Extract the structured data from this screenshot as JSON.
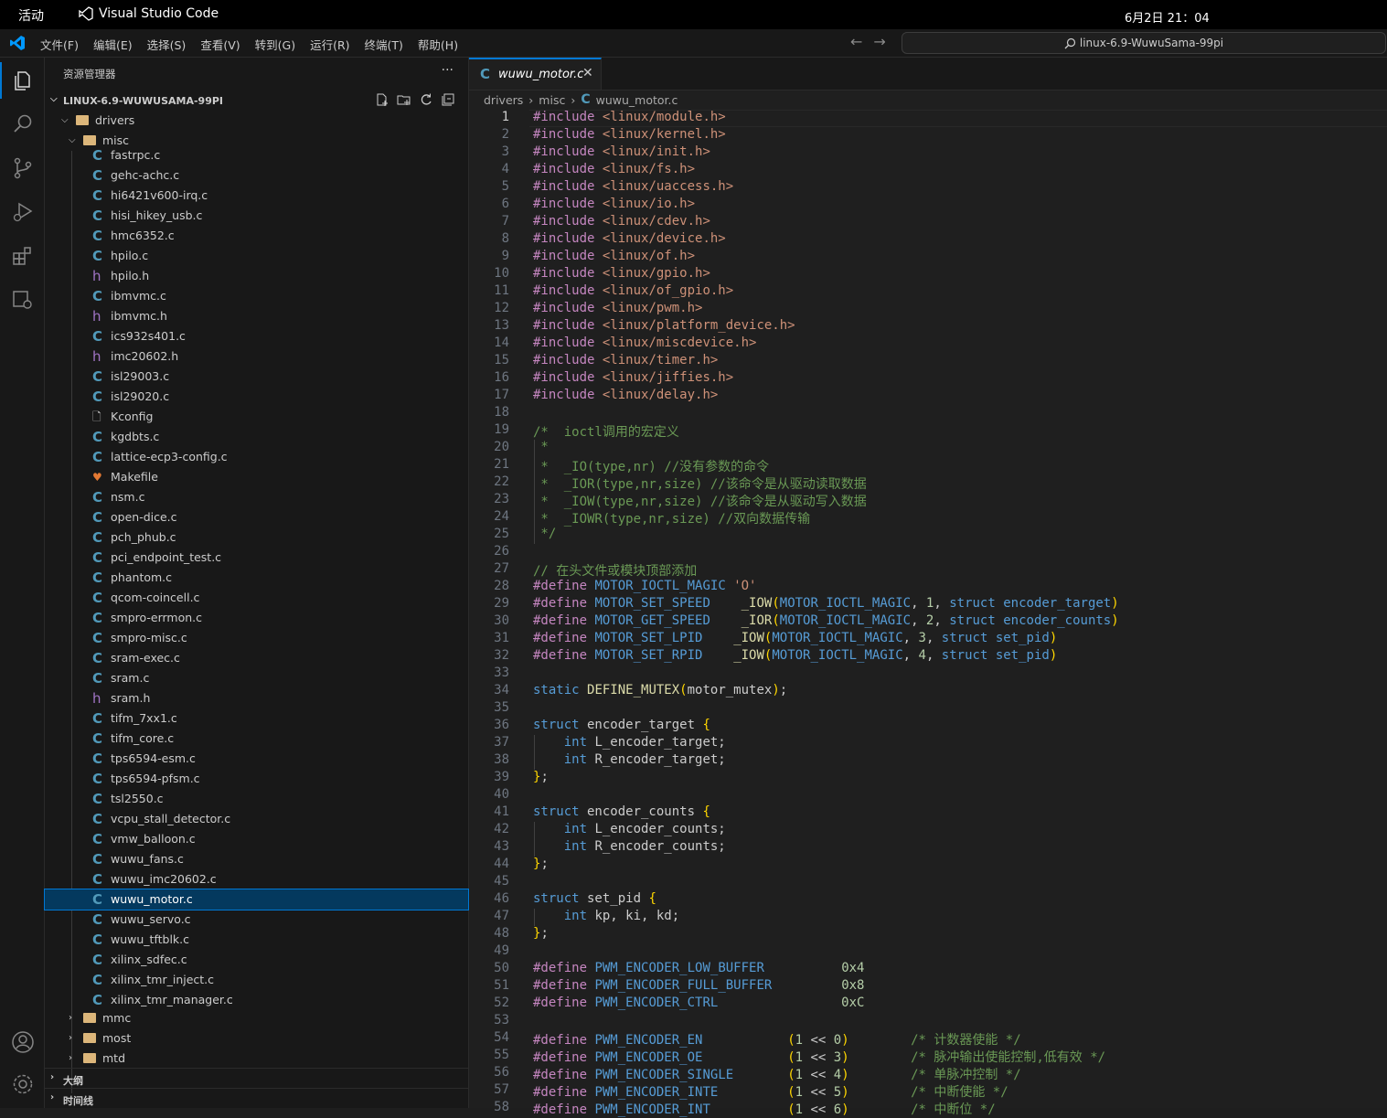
{
  "topbar": {
    "activities": "活动",
    "app_name": "Visual Studio Code",
    "clock": "6月2日  21：04"
  },
  "menubar": {
    "menus": [
      "文件(F)",
      "编辑(E)",
      "选择(S)",
      "查看(V)",
      "转到(G)",
      "运行(R)",
      "终端(T)",
      "帮助(H)"
    ],
    "search_text": "linux-6.9-WuwuSama-99pi"
  },
  "sidebar": {
    "title": "资源管理器",
    "project": "LINUX-6.9-WUWUSAMA-99PI",
    "folder_drivers": "drivers",
    "folder_misc": "misc",
    "files": [
      {
        "name": "fastrpc.c",
        "icon": "c-file-icon"
      },
      {
        "name": "gehc-achc.c",
        "icon": "c-file-icon"
      },
      {
        "name": "hi6421v600-irq.c",
        "icon": "c-file-icon"
      },
      {
        "name": "hisi_hikey_usb.c",
        "icon": "c-file-icon"
      },
      {
        "name": "hmc6352.c",
        "icon": "c-file-icon"
      },
      {
        "name": "hpilo.c",
        "icon": "c-file-icon"
      },
      {
        "name": "hpilo.h",
        "icon": "h-file-icon"
      },
      {
        "name": "ibmvmc.c",
        "icon": "c-file-icon"
      },
      {
        "name": "ibmvmc.h",
        "icon": "h-file-icon"
      },
      {
        "name": "ics932s401.c",
        "icon": "c-file-icon"
      },
      {
        "name": "imc20602.h",
        "icon": "h-file-icon"
      },
      {
        "name": "isl29003.c",
        "icon": "c-file-icon"
      },
      {
        "name": "isl29020.c",
        "icon": "c-file-icon"
      },
      {
        "name": "Kconfig",
        "icon": "kconfig-file-icon"
      },
      {
        "name": "kgdbts.c",
        "icon": "c-file-icon"
      },
      {
        "name": "lattice-ecp3-config.c",
        "icon": "c-file-icon"
      },
      {
        "name": "Makefile",
        "icon": "makefile-icon"
      },
      {
        "name": "nsm.c",
        "icon": "c-file-icon"
      },
      {
        "name": "open-dice.c",
        "icon": "c-file-icon"
      },
      {
        "name": "pch_phub.c",
        "icon": "c-file-icon"
      },
      {
        "name": "pci_endpoint_test.c",
        "icon": "c-file-icon"
      },
      {
        "name": "phantom.c",
        "icon": "c-file-icon"
      },
      {
        "name": "qcom-coincell.c",
        "icon": "c-file-icon"
      },
      {
        "name": "smpro-errmon.c",
        "icon": "c-file-icon"
      },
      {
        "name": "smpro-misc.c",
        "icon": "c-file-icon"
      },
      {
        "name": "sram-exec.c",
        "icon": "c-file-icon"
      },
      {
        "name": "sram.c",
        "icon": "c-file-icon"
      },
      {
        "name": "sram.h",
        "icon": "h-file-icon"
      },
      {
        "name": "tifm_7xx1.c",
        "icon": "c-file-icon"
      },
      {
        "name": "tifm_core.c",
        "icon": "c-file-icon"
      },
      {
        "name": "tps6594-esm.c",
        "icon": "c-file-icon"
      },
      {
        "name": "tps6594-pfsm.c",
        "icon": "c-file-icon"
      },
      {
        "name": "tsl2550.c",
        "icon": "c-file-icon"
      },
      {
        "name": "vcpu_stall_detector.c",
        "icon": "c-file-icon"
      },
      {
        "name": "vmw_balloon.c",
        "icon": "c-file-icon"
      },
      {
        "name": "wuwu_fans.c",
        "icon": "c-file-icon"
      },
      {
        "name": "wuwu_imc20602.c",
        "icon": "c-file-icon"
      },
      {
        "name": "wuwu_motor.c",
        "icon": "c-file-icon",
        "selected": true
      },
      {
        "name": "wuwu_servo.c",
        "icon": "c-file-icon"
      },
      {
        "name": "wuwu_tftblk.c",
        "icon": "c-file-icon"
      },
      {
        "name": "xilinx_sdfec.c",
        "icon": "c-file-icon"
      },
      {
        "name": "xilinx_tmr_inject.c",
        "icon": "c-file-icon"
      },
      {
        "name": "xilinx_tmr_manager.c",
        "icon": "c-file-icon"
      }
    ],
    "collapsed_folders": [
      "mmc",
      "most",
      "mtd"
    ],
    "outline": "大纲",
    "timeline": "时间线"
  },
  "editor": {
    "tab_label": "wuwu_motor.c",
    "breadcrumb": [
      "drivers",
      "misc",
      "wuwu_motor.c"
    ],
    "current_line": 1,
    "lines": [
      "#include <linux/module.h>",
      "#include <linux/kernel.h>",
      "#include <linux/init.h>",
      "#include <linux/fs.h>",
      "#include <linux/uaccess.h>",
      "#include <linux/io.h>",
      "#include <linux/cdev.h>",
      "#include <linux/device.h>",
      "#include <linux/of.h>",
      "#include <linux/gpio.h>",
      "#include <linux/of_gpio.h>",
      "#include <linux/pwm.h>",
      "#include <linux/platform_device.h>",
      "#include <linux/miscdevice.h>",
      "#include <linux/timer.h>",
      "#include <linux/jiffies.h>",
      "#include <linux/delay.h>",
      "",
      "/*  ioctl调用的宏定义",
      " *",
      " *  _IO(type,nr) //没有参数的命令",
      " *  _IOR(type,nr,size) //该命令是从驱动读取数据",
      " *  _IOW(type,nr,size) //该命令是从驱动写入数据",
      " *  _IOWR(type,nr,size) //双向数据传输",
      " */",
      "",
      "// 在头文件或模块顶部添加",
      "#define MOTOR_IOCTL_MAGIC 'O'",
      "#define MOTOR_SET_SPEED    _IOW(MOTOR_IOCTL_MAGIC, 1, struct encoder_target)",
      "#define MOTOR_GET_SPEED    _IOR(MOTOR_IOCTL_MAGIC, 2, struct encoder_counts)",
      "#define MOTOR_SET_LPID    _IOW(MOTOR_IOCTL_MAGIC, 3, struct set_pid)",
      "#define MOTOR_SET_RPID    _IOW(MOTOR_IOCTL_MAGIC, 4, struct set_pid)",
      "",
      "static DEFINE_MUTEX(motor_mutex);",
      "",
      "struct encoder_target {",
      "    int L_encoder_target;",
      "    int R_encoder_target;",
      "};",
      "",
      "struct encoder_counts {",
      "    int L_encoder_counts;",
      "    int R_encoder_counts;",
      "};",
      "",
      "struct set_pid {",
      "    int kp, ki, kd;",
      "};",
      "",
      "#define PWM_ENCODER_LOW_BUFFER          0x4",
      "#define PWM_ENCODER_FULL_BUFFER         0x8",
      "#define PWM_ENCODER_CTRL                0xC",
      "",
      "#define PWM_ENCODER_EN           (1 << 0)        /* 计数器使能 */",
      "#define PWM_ENCODER_OE           (1 << 3)        /* 脉冲输出使能控制,低有效 */",
      "#define PWM_ENCODER_SINGLE       (1 << 4)        /* 单脉冲控制 */",
      "#define PWM_ENCODER_INTE         (1 << 5)        /* 中断使能 */",
      "#define PWM_ENCODER_INT          (1 << 6)        /* 中断位 */"
    ]
  },
  "colors": {
    "accent": "#0078d4",
    "c_icon": "#519aba",
    "h_icon": "#a074c4",
    "folder": "#dcb67a"
  }
}
